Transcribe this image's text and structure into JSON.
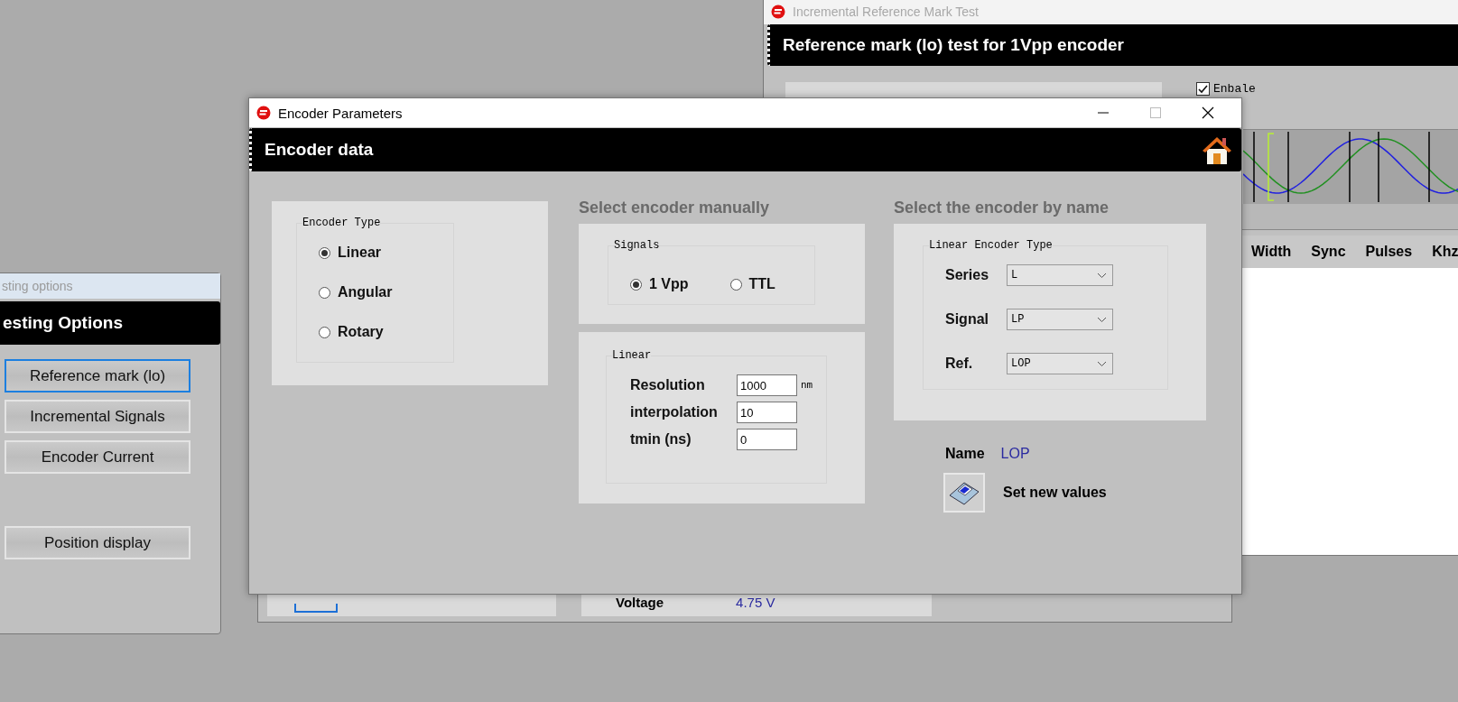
{
  "reference_mark_window": {
    "title": "Incremental Reference Mark Test",
    "header": "Reference mark (lo)  test for 1Vpp encoder",
    "enable": {
      "label": "Enbale",
      "checked": true
    },
    "table": {
      "columns": [
        "Width",
        "Sync",
        "Pulses",
        "Khz"
      ]
    }
  },
  "current_window": {
    "label": "Voltage",
    "value": "4.75 V"
  },
  "testing_options_window": {
    "title": "sting options",
    "header": "esting Options",
    "buttons": [
      {
        "label": "Reference mark (lo)",
        "focused": true
      },
      {
        "label": "Incremental Signals",
        "focused": false
      },
      {
        "label": "Encoder Current",
        "focused": false
      },
      {
        "label": "Position display",
        "focused": false
      }
    ]
  },
  "encoder_window": {
    "title": "Encoder Parameters",
    "header": "Encoder data",
    "encoder_type": {
      "caption": "Encoder Type",
      "options": [
        {
          "label": "Linear",
          "selected": true
        },
        {
          "label": "Angular",
          "selected": false
        },
        {
          "label": "Rotary",
          "selected": false
        }
      ]
    },
    "manual": {
      "title": "Select encoder manually",
      "signals": {
        "caption": "Signals",
        "options": [
          {
            "label": "1 Vpp",
            "selected": true
          },
          {
            "label": "TTL",
            "selected": false
          }
        ]
      },
      "linear": {
        "caption": "Linear",
        "fields": [
          {
            "label": "Resolution",
            "value": "1000",
            "unit": "nm"
          },
          {
            "label": "interpolation",
            "value": "10"
          },
          {
            "label": "tmin (ns)",
            "value": "0"
          }
        ]
      }
    },
    "by_name": {
      "title": "Select the encoder by name",
      "caption": "Linear Encoder Type",
      "selects": [
        {
          "label": "Series",
          "value": "L"
        },
        {
          "label": "Signal",
          "value": "LP"
        },
        {
          "label": "Ref.",
          "value": "LOP"
        }
      ],
      "name_label": "Name",
      "name_value": "LOP",
      "set_button": "Set new values"
    }
  }
}
